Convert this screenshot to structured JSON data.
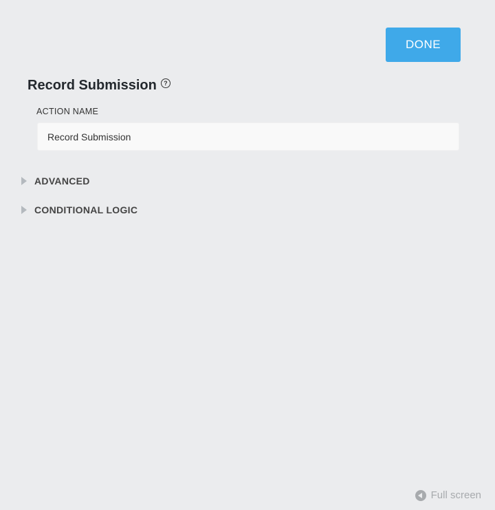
{
  "header": {
    "done_label": "DONE"
  },
  "panel": {
    "title": "Record Submission",
    "help_icon_glyph": "?"
  },
  "form": {
    "action_name_label": "ACTION NAME",
    "action_name_value": "Record Submission"
  },
  "sections": {
    "advanced_label": "ADVANCED",
    "conditional_logic_label": "CONDITIONAL LOGIC"
  },
  "footer": {
    "fullscreen_label": "Full screen"
  },
  "colors": {
    "accent": "#3fa9e9",
    "background": "#ebecee",
    "muted": "#a7aaad"
  },
  "icons": {
    "help": "help-icon",
    "advanced_toggle": "triangle-right-icon",
    "conditional_toggle": "triangle-right-icon",
    "fullscreen": "collapse-left-icon"
  }
}
